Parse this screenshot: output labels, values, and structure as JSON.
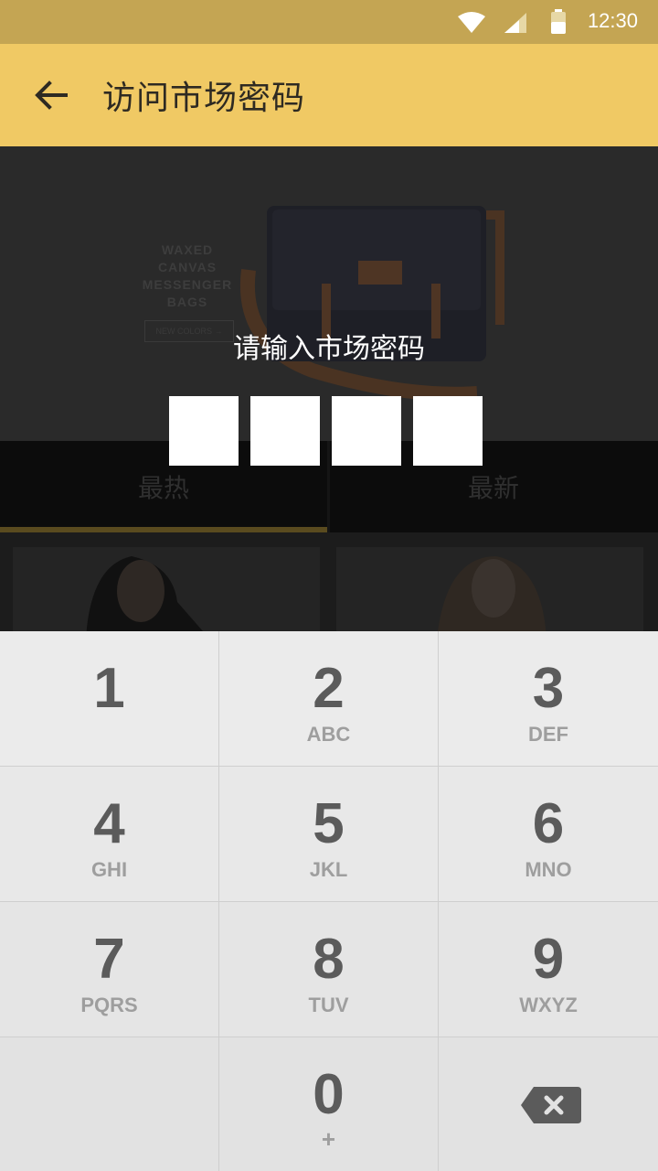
{
  "status_bar": {
    "time": "12:30"
  },
  "app_bar": {
    "title": "访问市场密码"
  },
  "banner": {
    "product_text": [
      "WAXED",
      "CANVAS",
      "MESSENGER",
      "BAGS"
    ],
    "button_text": "NEW COLORS →"
  },
  "tabs": [
    {
      "label": "最热",
      "selected": true
    },
    {
      "label": "最新",
      "selected": false
    }
  ],
  "dialog": {
    "prompt": "请输入市场密码",
    "pin_length": 4,
    "pin_entered": 0
  },
  "keypad": [
    {
      "digit": "1",
      "letters": ""
    },
    {
      "digit": "2",
      "letters": "ABC"
    },
    {
      "digit": "3",
      "letters": "DEF"
    },
    {
      "digit": "4",
      "letters": "GHI"
    },
    {
      "digit": "5",
      "letters": "JKL"
    },
    {
      "digit": "6",
      "letters": "MNO"
    },
    {
      "digit": "7",
      "letters": "PQRS"
    },
    {
      "digit": "8",
      "letters": "TUV"
    },
    {
      "digit": "9",
      "letters": "WXYZ"
    },
    {
      "digit": "0",
      "letters": "+"
    }
  ],
  "colors": {
    "status_bar": "#c4a553",
    "app_bar": "#f0c964",
    "keypad_bg": "#e6e6e6",
    "key_digit": "#5b5b5b",
    "key_letters": "#9e9e9e"
  }
}
